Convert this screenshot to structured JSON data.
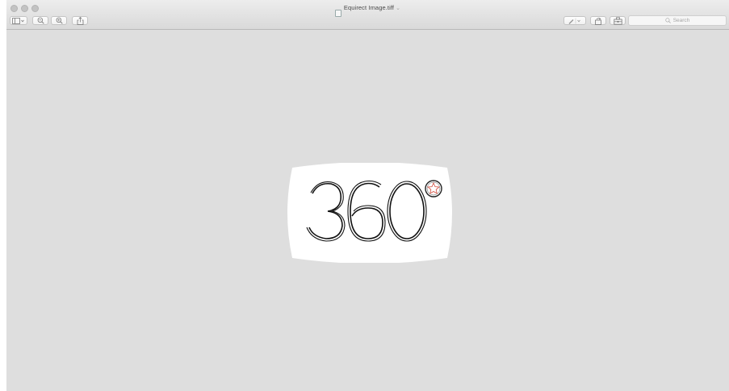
{
  "window": {
    "title": "Equirect Image.tiff",
    "title_chevron": "⌄"
  },
  "toolbar": {
    "sidebar_icon": "sidebar-icon",
    "zoom_out_icon": "zoom-out-icon",
    "zoom_in_icon": "zoom-in-icon",
    "share_icon": "share-icon",
    "markup_icon": "pen-icon",
    "rotate_icon": "rotate-icon",
    "toolbox_icon": "toolbox-icon",
    "search_placeholder": "Search"
  },
  "document": {
    "text": "360",
    "degree_symbol": "star-circle-icon",
    "accent_color": "#d2493a",
    "background": "#dedede"
  }
}
